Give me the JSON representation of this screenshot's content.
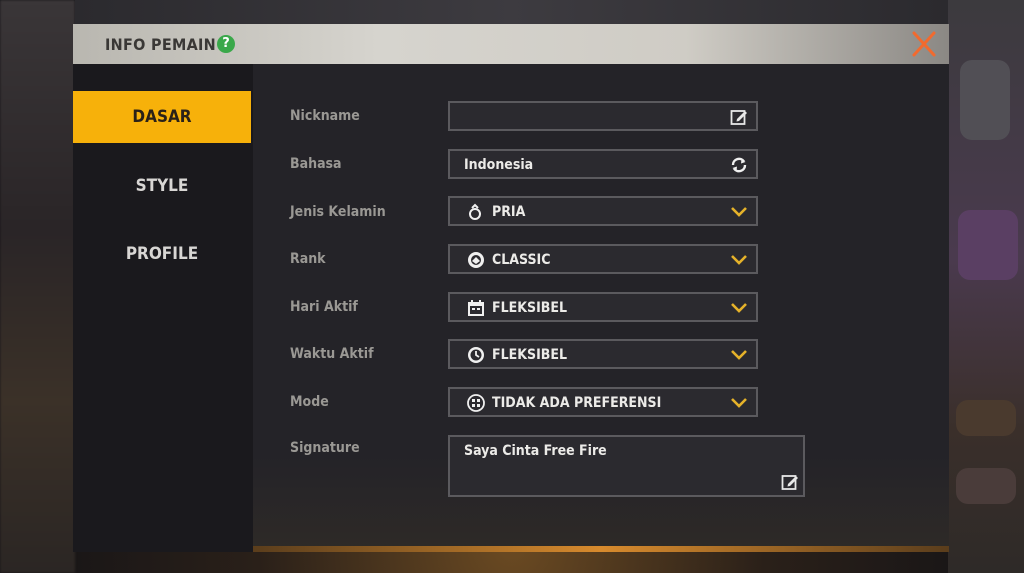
{
  "dialog": {
    "title": "INFO PEMAIN",
    "help_icon": "?"
  },
  "sidebar": {
    "tabs": [
      {
        "label": "DASAR",
        "active": true
      },
      {
        "label": "STYLE",
        "active": false
      },
      {
        "label": "PROFILE",
        "active": false
      }
    ]
  },
  "form": {
    "nickname": {
      "label": "Nickname",
      "value": "",
      "icon": "edit-icon"
    },
    "bahasa": {
      "label": "Bahasa",
      "value": "Indonesia",
      "icon": "refresh-icon"
    },
    "jenis_kelamin": {
      "label": "Jenis Kelamin",
      "value": "PRIA",
      "icon": "male-icon"
    },
    "rank": {
      "label": "Rank",
      "value": "CLASSIC",
      "icon": "rank-icon"
    },
    "hari_aktif": {
      "label": "Hari Aktif",
      "value": "FLEKSIBEL",
      "icon": "calendar-icon"
    },
    "waktu_aktif": {
      "label": "Waktu Aktif",
      "value": "FLEKSIBEL",
      "icon": "clock-icon"
    },
    "mode": {
      "label": "Mode",
      "value": "TIDAK ADA PREFERENSI",
      "icon": "mode-icon"
    },
    "signature": {
      "label": "Signature",
      "value": "Saya Cinta Free Fire",
      "icon": "edit-icon"
    }
  },
  "colors": {
    "accent": "#f7b10a",
    "close": "#f26a2e",
    "chevron": "#e5b22a",
    "help": "#3aa84a"
  }
}
